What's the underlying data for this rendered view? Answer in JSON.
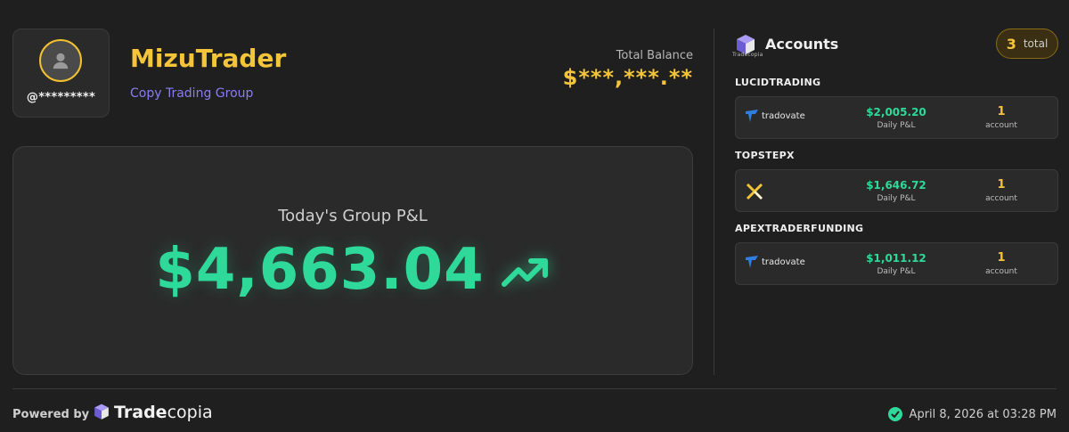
{
  "profile": {
    "handle": "@*********",
    "username": "MizuTrader",
    "group_label": "Copy Trading Group",
    "avatar_icon": "user-icon"
  },
  "balance": {
    "label": "Total Balance",
    "value": "$***,***.**"
  },
  "group_pnl": {
    "title": "Today's Group P&L",
    "value": "$4,663.04",
    "trend_icon": "trend-up-icon"
  },
  "accounts": {
    "title": "Accounts",
    "logo_text": "Tradecopia",
    "total_count": "3",
    "total_label": "total",
    "firms": [
      {
        "name": "LUCIDTRADING",
        "broker": "tradovate",
        "pnl": "$2,005.20",
        "pnl_label": "Daily P&L",
        "count": "1",
        "count_label": "account"
      },
      {
        "name": "TOPSTEPX",
        "broker": "",
        "pnl": "$1,646.72",
        "pnl_label": "Daily P&L",
        "count": "1",
        "count_label": "account"
      },
      {
        "name": "APEXTRADERFUNDING",
        "broker": "tradovate",
        "pnl": "$1,011.12",
        "pnl_label": "Daily P&L",
        "count": "1",
        "count_label": "account"
      }
    ]
  },
  "footer": {
    "powered_by": "Powered by",
    "brand_bold": "Trade",
    "brand_light": "copia",
    "timestamp": "April 8, 2026 at 03:28 PM"
  },
  "colors": {
    "background": "#1f1f1f",
    "accent_gold": "#f4c53a",
    "positive_green": "#2fd99a",
    "group_purple": "#8a7cf2"
  }
}
